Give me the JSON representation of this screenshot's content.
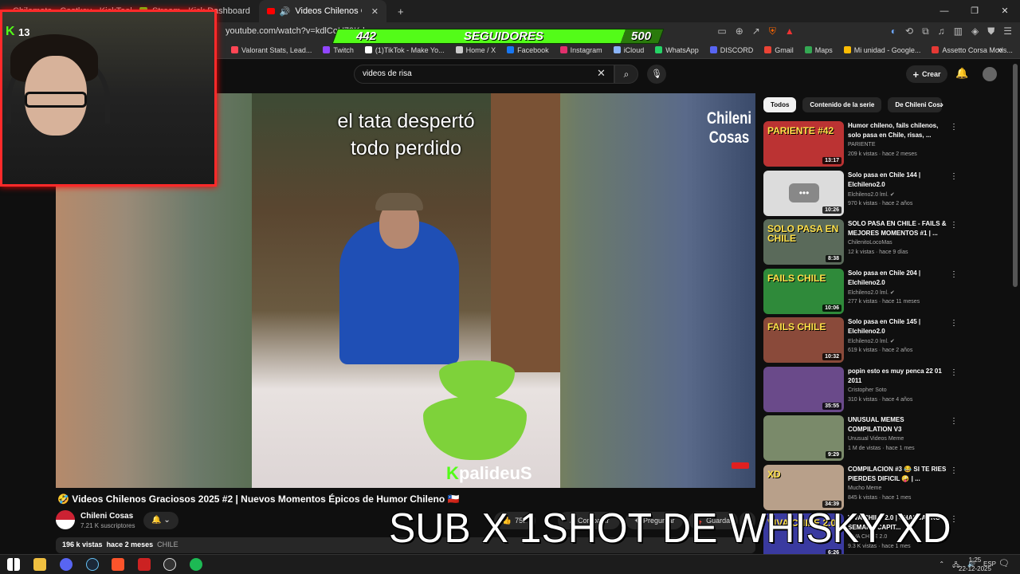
{
  "browser": {
    "tabs": [
      {
        "label": "Chilemata · Castkey · KickTools",
        "active": false
      },
      {
        "label": "Stream · Kick Dashboard",
        "active": false
      },
      {
        "label": "Videos Chilenos Graciosos",
        "active": true
      }
    ],
    "url": "youtube.com/watch?v=kdlCoU79K-l",
    "bookmarks": [
      {
        "label": "Valorant Stats, Lead...",
        "color": "#ff4655"
      },
      {
        "label": "Twitch",
        "color": "#9146ff"
      },
      {
        "label": "(1)TikTok - Make Yo...",
        "color": "#ffffff"
      },
      {
        "label": "Home / X",
        "color": "#cccccc"
      },
      {
        "label": "Facebook",
        "color": "#1877f2"
      },
      {
        "label": "Instagram",
        "color": "#e1306c"
      },
      {
        "label": "iCloud",
        "color": "#8ab4f8"
      },
      {
        "label": "WhatsApp",
        "color": "#25d366"
      },
      {
        "label": "DISCORD",
        "color": "#5865f2"
      },
      {
        "label": "Gmail",
        "color": "#ea4335"
      },
      {
        "label": "Maps",
        "color": "#34a853"
      },
      {
        "label": "Mi unidad - Google...",
        "color": "#fbbc04"
      },
      {
        "label": "Assetto Corsa Mods...",
        "color": "#e53935"
      }
    ]
  },
  "overlay": {
    "kick_count": "13",
    "followers_current": "442",
    "followers_label": "SEGUIDORES",
    "followers_goal": "500",
    "followers_progress": 0.884,
    "big_text": "SUB X 1SHOT DE WHISKY XD"
  },
  "youtube": {
    "search_value": "videos de risa",
    "create_label": "Crear",
    "video": {
      "caption_line1": "el tata despertó",
      "caption_line2": "todo perdido",
      "watermark": "palideuS",
      "channel_logo_line1": "Chileni",
      "channel_logo_line2": "Cosas",
      "title": "🤣 Videos Chilenos Graciosos 2025 #2 | Nuevos Momentos Épicos de Humor Chileno 🇨🇱",
      "channel": "Chileni Cosas",
      "subscribers": "7.21 K suscriptores",
      "likes": "758",
      "share": "Compartir",
      "ask": "Preguntar",
      "save": "Guardar",
      "views": "196 k vistas",
      "age": "hace 2 meses",
      "tag": "CHILE"
    },
    "chips": [
      "Todos",
      "Contenido de la serie",
      "De Chileni Cosas"
    ],
    "recommendations": [
      {
        "title": "Humor chileno, fails chilenos, solo pasa en Chile, risas, ...",
        "channel": "PARIENTE",
        "meta": "209 k vistas · hace 2 meses",
        "duration": "13:17",
        "thumb_text": "PARIENTE #42",
        "thumb_bg": "#b33"
      },
      {
        "title": "Solo pasa en Chile 144 | Elchileno2.0",
        "channel": "Elchileno2.0 lml. ✔",
        "meta": "970 k vistas · hace 2 años",
        "duration": "10:26",
        "thumb_text": "",
        "thumb_bg": "#dcdcdc"
      },
      {
        "title": "SOLO PASA EN CHILE - FAILS & MEJORES MOMENTOS #1 | ...",
        "channel": "ChilenitoLocoMas",
        "meta": "12 k vistas · hace 9 días",
        "duration": "8:38",
        "thumb_text": "SOLO PASA EN CHILE",
        "thumb_bg": "#5a6a5a"
      },
      {
        "title": "Solo pasa en Chile 204 | Elchileno2.0",
        "channel": "Elchileno2.0 lml. ✔",
        "meta": "277 k vistas · hace 11 meses",
        "duration": "10:06",
        "thumb_text": "FAILS CHILE",
        "thumb_bg": "#2f8a3a"
      },
      {
        "title": "Solo pasa en Chile 145 | Elchileno2.0",
        "channel": "Elchileno2.0 lml. ✔",
        "meta": "619 k vistas · hace 2 años",
        "duration": "10:32",
        "thumb_text": "FAILS CHILE",
        "thumb_bg": "#8a4a3a"
      },
      {
        "title": "popin esto es muy penca 22 01 2011",
        "channel": "Cristopher Soto",
        "meta": "310 k vistas · hace 4 años",
        "duration": "35:55",
        "thumb_text": "",
        "thumb_bg": "#6a4a8a"
      },
      {
        "title": "UNUSUAL MEMES COMPILATION V3",
        "channel": "Unusual Videos Meme",
        "meta": "1 M de vistas · hace 1 mes",
        "duration": "9:29",
        "thumb_text": "",
        "thumb_bg": "#7a8a6a"
      },
      {
        "title": "COMPILACION #3 😂 SI TE RIES PIERDES DIFICIL 🤪 | ...",
        "channel": "Mucho Meme",
        "meta": "845 k vistas · hace 1 mes",
        "duration": "34:39",
        "thumb_text": "XD",
        "thumb_bg": "#b8a08a"
      },
      {
        "title": "VIVA CHILE 2.0 | CHASCARRO SEMANA CAPIT...",
        "channel": "VIVA CHILE 2.0",
        "meta": "9.3 K vistas · hace 1 mes",
        "duration": "6:26",
        "thumb_text": "VIVA CHILE 2.0",
        "thumb_bg": "#3a3aa0"
      }
    ]
  },
  "taskbar": {
    "lang": "ESP",
    "time": "1:25",
    "date": "22-12-2025"
  }
}
